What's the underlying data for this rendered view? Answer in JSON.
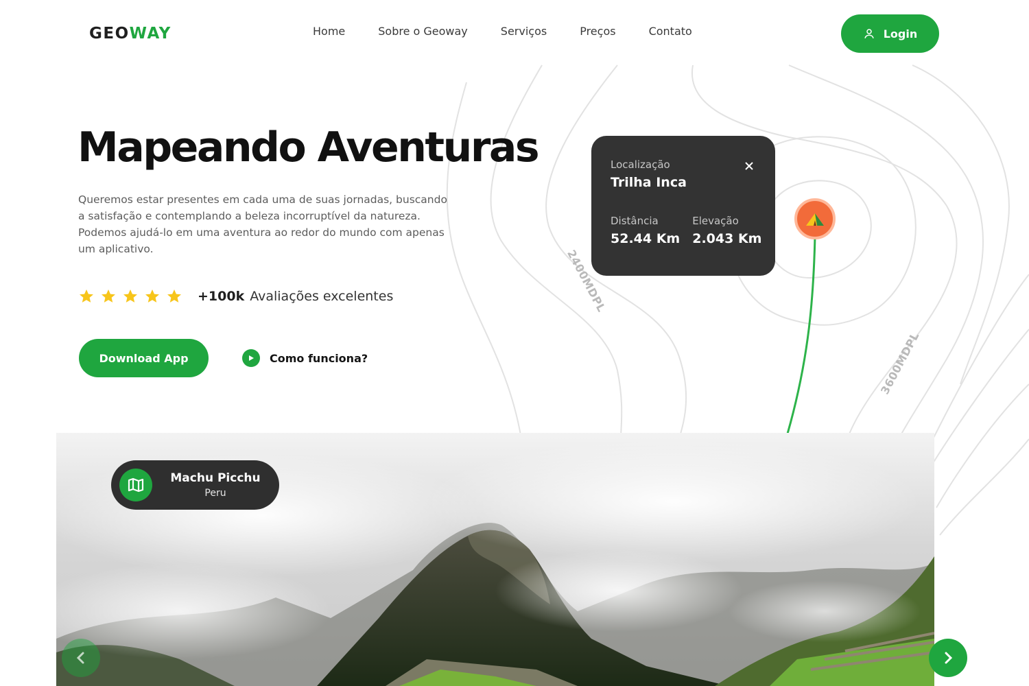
{
  "brand": {
    "name_part1": "GEO",
    "name_part2": "WAY"
  },
  "nav": {
    "items": [
      "Home",
      "Sobre o Geoway",
      "Serviços",
      "Preços",
      "Contato"
    ]
  },
  "header": {
    "login_label": "Login"
  },
  "hero": {
    "title": "Mapeando Aventuras",
    "description": "Queremos estar presentes em cada uma de suas jornadas, buscando a satisfação e contemplando a beleza incorruptível da natureza. Podemos ajudá-lo em uma aventura ao redor do mundo com apenas um aplicativo.",
    "rating": {
      "stars": 5,
      "count": "+100k",
      "label": "Avaliações excelentes"
    },
    "download_label": "Download App",
    "how_label": "Como funciona?"
  },
  "map": {
    "contour_labels": [
      "2400MDPL",
      "3600MDPL"
    ],
    "card": {
      "location_label": "Localização",
      "location_name": "Trilha Inca",
      "distance_label": "Distância",
      "distance_value": "52.44 Km",
      "elevation_label": "Elevação",
      "elevation_value": "2.043 Km"
    }
  },
  "destination": {
    "name": "Machu Picchu",
    "country": "Peru"
  },
  "icons": [
    "user-icon",
    "star-icon",
    "play-icon",
    "close-icon",
    "camp-icon",
    "map-icon",
    "chevron-left-icon",
    "chevron-right-icon"
  ],
  "colors": {
    "accent": "#1fa63f",
    "star": "#f7c51b",
    "card": "#333333",
    "marker": "#f26b3a"
  }
}
